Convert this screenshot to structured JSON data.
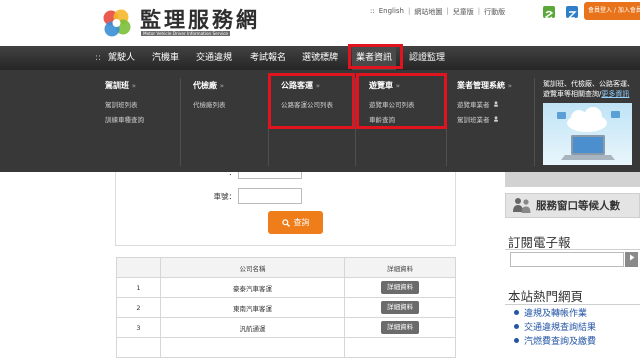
{
  "header": {
    "logo_title": "監理服務網",
    "logo_subtitle": "Motor Vehicle Driver Information Service",
    "top_links_prefix": "::",
    "top_links": [
      "English",
      "網站地圖",
      "兒童版",
      "行動版"
    ],
    "separator": "|",
    "icons": [
      "green-share-icon",
      "blue-translate-icon"
    ],
    "member_button": "會員登入 / 加入會員"
  },
  "nav": {
    "prefix": "::",
    "items": [
      "駕駛人",
      "汽機車",
      "交通違規",
      "考試報名",
      "選號標牌",
      "業者資訊",
      "認證監理"
    ],
    "active": "業者資訊"
  },
  "mega_menu": {
    "arrow": "»",
    "columns": [
      {
        "title": "駕訓班",
        "links": [
          "駕訓班列表",
          "訓練車種查詢"
        ]
      },
      {
        "title": "代檢廠",
        "links": [
          "代檢廠列表"
        ]
      },
      {
        "title": "公路客運",
        "links": [
          "公路客運公司列表"
        ]
      },
      {
        "title": "遊覽車",
        "links": [
          "遊覽車公司列表",
          "車齡查詢"
        ]
      },
      {
        "title": "業者管理系統",
        "links": [
          "遊覽車業者",
          "駕訓班業者"
        ]
      }
    ],
    "promo": {
      "text": "駕訓班、代檢廠、公路客運、遊覽車等相關查詢/",
      "link": "更多資訊"
    }
  },
  "form": {
    "hidden_row_label": "：",
    "plate_label": "車號：",
    "plate_value": "",
    "search_button": "查詢"
  },
  "table": {
    "headers": {
      "company": "公司名稱",
      "detail": "詳細資料"
    },
    "rows": [
      {
        "no": "1",
        "name": "豪泰汽車客運",
        "action": "詳細資料"
      },
      {
        "no": "2",
        "name": "東南汽車客運",
        "action": "詳細資料"
      },
      {
        "no": "3",
        "name": "汎航通運",
        "action": "詳細資料"
      },
      {
        "no": "",
        "name": "",
        "action": ""
      }
    ]
  },
  "sidebar": {
    "queue_box": "服務窗口等候人數",
    "newsletter_heading": "訂閱電子報",
    "newsletter_value": "",
    "hot_heading": "本站熱門網頁",
    "hot_items": [
      "違規及轉帳作業",
      "交通違規查詢結果",
      "汽燃費查詢及繳費"
    ]
  },
  "colors": {
    "accent_orange": "#ef7d1a",
    "highlight_red": "#e0141e",
    "nav_dark": "#2e2e2e",
    "link_blue": "#2456a6"
  }
}
